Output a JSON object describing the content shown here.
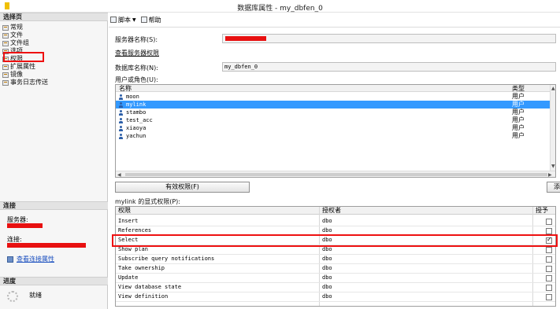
{
  "window": {
    "title": "数据库属性 - my_dbfen_0"
  },
  "left_pane": {
    "select_page_header": "选择页",
    "nav_items": [
      "常规",
      "文件",
      "文件组",
      "选项",
      "权限",
      "扩展属性",
      "镜像",
      "事务日志传送"
    ],
    "connection_header": "连接",
    "server_label": "服务器:",
    "connection_label": "连接:",
    "view_connection_link": "查看连接属性",
    "progress_header": "进度",
    "progress_status": "就绪"
  },
  "toolbar": {
    "script_label": "脚本",
    "help_label": "帮助"
  },
  "form": {
    "server_name_label": "服务器名称(S):",
    "view_server_perms_link": "查看服务器权限",
    "db_name_label": "数据库名称(N):",
    "db_name_value": "my_dbfen_0",
    "users_roles_label": "用户或角色(U):",
    "effective_perms_button": "有效权限(F)",
    "add_button_partial": "添",
    "explicit_perms_label": "mylink 的显式权限(P):"
  },
  "users_table": {
    "col_name": "名称",
    "col_type": "类型",
    "rows": [
      {
        "name": "moon",
        "type": "用户"
      },
      {
        "name": "mylink",
        "type": "用户"
      },
      {
        "name": "stambo",
        "type": "用户"
      },
      {
        "name": "test_acc",
        "type": "用户"
      },
      {
        "name": "xiaoya",
        "type": "用户"
      },
      {
        "name": "yachun",
        "type": "用户"
      }
    ]
  },
  "perms_table": {
    "col_permission": "权限",
    "col_grantor": "授权者",
    "col_grant": "授予",
    "rows": [
      {
        "permission": "Insert",
        "grantor": "dbo",
        "granted": false
      },
      {
        "permission": "References",
        "grantor": "dbo",
        "granted": false
      },
      {
        "permission": "Select",
        "grantor": "dbo",
        "granted": true
      },
      {
        "permission": "Show plan",
        "grantor": "dbo",
        "granted": false
      },
      {
        "permission": "Subscribe query notifications",
        "grantor": "dbo",
        "granted": false
      },
      {
        "permission": "Take ownership",
        "grantor": "dbo",
        "granted": false
      },
      {
        "permission": "Update",
        "grantor": "dbo",
        "granted": false
      },
      {
        "permission": "View database state",
        "grantor": "dbo",
        "granted": false
      },
      {
        "permission": "View definition",
        "grantor": "dbo",
        "granted": false
      }
    ]
  },
  "colors": {
    "highlight_red": "#e11111",
    "selection_blue": "#3399ff",
    "link_blue": "#1a4fbf"
  }
}
